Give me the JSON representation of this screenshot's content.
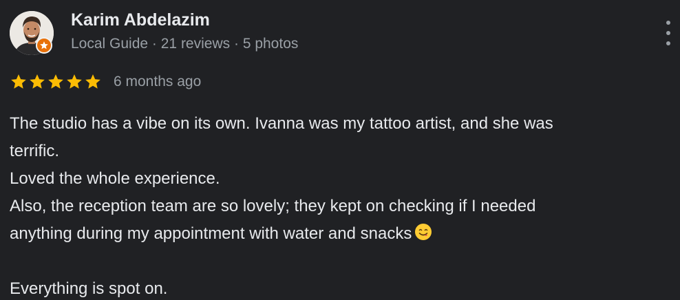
{
  "author": {
    "name": "Karim Abdelazim",
    "badge": "Local Guide",
    "separator_1": " · ",
    "reviews": "21 reviews",
    "separator_2": " · ",
    "photos": "5 photos"
  },
  "rating": {
    "stars": 5,
    "star_color": "#fbbc04",
    "date": "6 months ago"
  },
  "review": {
    "lines": [
      "The studio has a vibe on its own. Ivanna was my tattoo artist, and she was",
      "terrific.",
      "Loved the whole experience.",
      "Also, the reception team are so lovely; they kept on checking if I needed",
      "anything during my appointment with water and snacks",
      "",
      "Everything is spot on."
    ],
    "emoji": "face-savoring-food-emoji"
  },
  "icons": {
    "more": "more-vertical-icon",
    "star": "star-icon",
    "guide_badge": "local-guide-star-icon"
  },
  "colors": {
    "background": "#202124",
    "primary_text": "#e8eaed",
    "secondary_text": "#9aa0a6",
    "badge_orange": "#e8710a"
  }
}
